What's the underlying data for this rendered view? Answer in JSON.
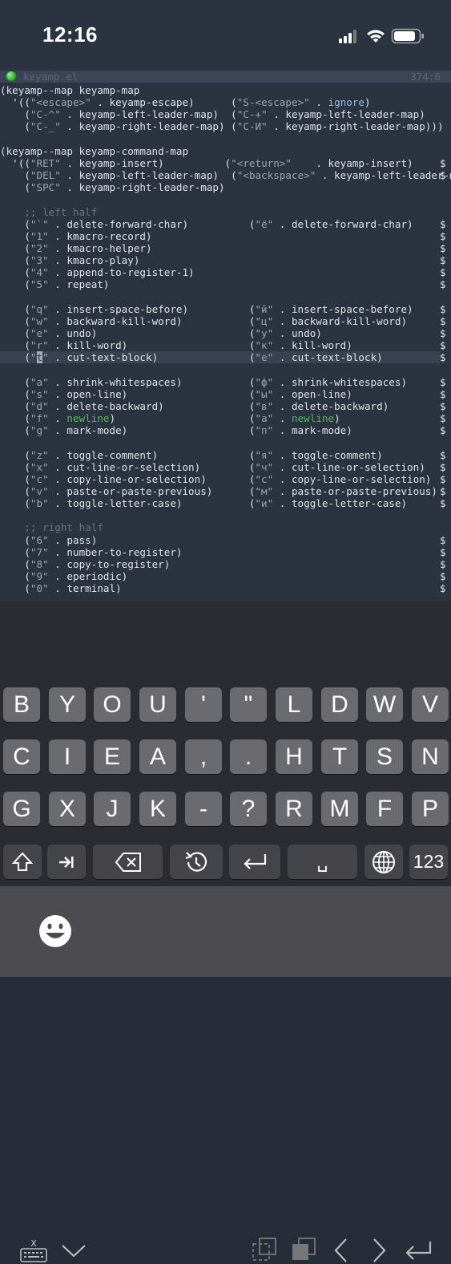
{
  "status_bar": {
    "time": "12:16"
  },
  "editor": {
    "filename": "keyamp.el",
    "position": "374:6",
    "lines": [
      {
        "segs": [
          {
            "t": "(keyamp--map keyamp-map",
            "c": "s"
          }
        ]
      },
      {
        "segs": [
          {
            "t": "  '((",
            "c": "s"
          },
          {
            "t": "\"<escape>\"",
            "c": "q"
          },
          {
            "t": " . keyamp-escape)      (",
            "c": "s"
          },
          {
            "t": "\"S-<escape>\"",
            "c": "q"
          },
          {
            "t": " . ",
            "c": "s"
          },
          {
            "t": "ignore",
            "c": "k"
          },
          {
            "t": ")",
            "c": "s"
          }
        ]
      },
      {
        "segs": [
          {
            "t": "    (",
            "c": "s"
          },
          {
            "t": "\"C-^\"",
            "c": "q"
          },
          {
            "t": " . keyamp-left-leader-map)  (",
            "c": "s"
          },
          {
            "t": "\"C-+\"",
            "c": "q"
          },
          {
            "t": " . keyamp-left-leader-map)",
            "c": "s"
          }
        ]
      },
      {
        "segs": [
          {
            "t": "    (",
            "c": "s"
          },
          {
            "t": "\"C-_\"",
            "c": "q"
          },
          {
            "t": " . keyamp-right-leader-map) (",
            "c": "s"
          },
          {
            "t": "\"C-И\"",
            "c": "q"
          },
          {
            "t": " . keyamp-right-leader-map)))",
            "c": "s"
          }
        ]
      },
      {
        "segs": []
      },
      {
        "segs": [
          {
            "t": "(keyamp--map keyamp-command-map",
            "c": "s"
          }
        ]
      },
      {
        "segs": [
          {
            "t": "  '((",
            "c": "s"
          },
          {
            "t": "\"RET\"",
            "c": "q"
          },
          {
            "t": " . keyamp-insert)          (",
            "c": "s"
          },
          {
            "t": "\"<return>\"",
            "c": "q"
          },
          {
            "t": "    . keyamp-insert)",
            "c": "s"
          }
        ],
        "dollar": true
      },
      {
        "segs": [
          {
            "t": "    (",
            "c": "s"
          },
          {
            "t": "\"DEL\"",
            "c": "q"
          },
          {
            "t": " . keyamp-left-leader-map)  (",
            "c": "s"
          },
          {
            "t": "\"<backspace>\"",
            "c": "q"
          },
          {
            "t": " . keyamp-left-leader-ma",
            "c": "s"
          }
        ],
        "dollar": true
      },
      {
        "segs": [
          {
            "t": "    (",
            "c": "s"
          },
          {
            "t": "\"SPC\"",
            "c": "q"
          },
          {
            "t": " . keyamp-right-leader-map)",
            "c": "s"
          }
        ]
      },
      {
        "segs": []
      },
      {
        "segs": [
          {
            "t": "    ;; left half",
            "c": "c"
          }
        ]
      },
      {
        "segs": [
          {
            "t": "    (",
            "c": "s"
          },
          {
            "t": "\"`\"",
            "c": "q"
          },
          {
            "t": " . delete-forward-char)          (",
            "c": "s"
          },
          {
            "t": "\"ё\"",
            "c": "q"
          },
          {
            "t": " . delete-forward-char)",
            "c": "s"
          }
        ],
        "dollar": true
      },
      {
        "segs": [
          {
            "t": "    (",
            "c": "s"
          },
          {
            "t": "\"1\"",
            "c": "q"
          },
          {
            "t": " . kmacro-record)",
            "c": "s"
          }
        ],
        "dollar": true
      },
      {
        "segs": [
          {
            "t": "    (",
            "c": "s"
          },
          {
            "t": "\"2\"",
            "c": "q"
          },
          {
            "t": " . kmacro-helper)",
            "c": "s"
          }
        ],
        "dollar": true
      },
      {
        "segs": [
          {
            "t": "    (",
            "c": "s"
          },
          {
            "t": "\"3\"",
            "c": "q"
          },
          {
            "t": " . kmacro-play)",
            "c": "s"
          }
        ],
        "dollar": true
      },
      {
        "segs": [
          {
            "t": "    (",
            "c": "s"
          },
          {
            "t": "\"4\"",
            "c": "q"
          },
          {
            "t": " . append-to-register-1)",
            "c": "s"
          }
        ],
        "dollar": true
      },
      {
        "segs": [
          {
            "t": "    (",
            "c": "s"
          },
          {
            "t": "\"5\"",
            "c": "q"
          },
          {
            "t": " . repeat)",
            "c": "s"
          }
        ],
        "dollar": true
      },
      {
        "segs": []
      },
      {
        "segs": [
          {
            "t": "    (",
            "c": "s"
          },
          {
            "t": "\"q\"",
            "c": "q"
          },
          {
            "t": " . insert-space-before)          (",
            "c": "s"
          },
          {
            "t": "\"й\"",
            "c": "q"
          },
          {
            "t": " . insert-space-before)",
            "c": "s"
          }
        ],
        "dollar": true
      },
      {
        "segs": [
          {
            "t": "    (",
            "c": "s"
          },
          {
            "t": "\"w\"",
            "c": "q"
          },
          {
            "t": " . backward-kill-word)           (",
            "c": "s"
          },
          {
            "t": "\"ц\"",
            "c": "q"
          },
          {
            "t": " . backward-kill-word)",
            "c": "s"
          }
        ],
        "dollar": true
      },
      {
        "segs": [
          {
            "t": "    (",
            "c": "s"
          },
          {
            "t": "\"e\"",
            "c": "q"
          },
          {
            "t": " . undo)                         (",
            "c": "s"
          },
          {
            "t": "\"у\"",
            "c": "q"
          },
          {
            "t": " . undo)",
            "c": "s"
          }
        ],
        "dollar": true
      },
      {
        "segs": [
          {
            "t": "    (",
            "c": "s"
          },
          {
            "t": "\"r\"",
            "c": "q"
          },
          {
            "t": " . kill-word)                    (",
            "c": "s"
          },
          {
            "t": "\"к\"",
            "c": "q"
          },
          {
            "t": " . kill-word)",
            "c": "s"
          }
        ],
        "dollar": true
      },
      {
        "segs": [
          {
            "t": "    (",
            "c": "s"
          },
          {
            "t": "\"",
            "c": "q"
          },
          {
            "t": "t",
            "c": "cursor"
          },
          {
            "t": "\"",
            "c": "q"
          },
          {
            "t": " . cut-text-block)               (",
            "c": "s"
          },
          {
            "t": "\"е\"",
            "c": "q"
          },
          {
            "t": " . cut-text-block)",
            "c": "s"
          }
        ],
        "dollar": true,
        "hl": true
      },
      {
        "segs": []
      },
      {
        "segs": [
          {
            "t": "    (",
            "c": "s"
          },
          {
            "t": "\"a\"",
            "c": "q"
          },
          {
            "t": " . shrink-whitespaces)           (",
            "c": "s"
          },
          {
            "t": "\"ф\"",
            "c": "q"
          },
          {
            "t": " . shrink-whitespaces)",
            "c": "s"
          }
        ],
        "dollar": true
      },
      {
        "segs": [
          {
            "t": "    (",
            "c": "s"
          },
          {
            "t": "\"s\"",
            "c": "q"
          },
          {
            "t": " . open-line)                    (",
            "c": "s"
          },
          {
            "t": "\"ы\"",
            "c": "q"
          },
          {
            "t": " . open-line)",
            "c": "s"
          }
        ],
        "dollar": true
      },
      {
        "segs": [
          {
            "t": "    (",
            "c": "s"
          },
          {
            "t": "\"d\"",
            "c": "q"
          },
          {
            "t": " . delete-backward)              (",
            "c": "s"
          },
          {
            "t": "\"в\"",
            "c": "q"
          },
          {
            "t": " . delete-backward)",
            "c": "s"
          }
        ],
        "dollar": true
      },
      {
        "segs": [
          {
            "t": "    (",
            "c": "s"
          },
          {
            "t": "\"f\"",
            "c": "q"
          },
          {
            "t": " . ",
            "c": "s"
          },
          {
            "t": "newline",
            "c": "g"
          },
          {
            "t": ")                      (",
            "c": "s"
          },
          {
            "t": "\"а\"",
            "c": "q"
          },
          {
            "t": " . ",
            "c": "s"
          },
          {
            "t": "newline",
            "c": "g"
          },
          {
            "t": ")",
            "c": "s"
          }
        ],
        "dollar": true
      },
      {
        "segs": [
          {
            "t": "    (",
            "c": "s"
          },
          {
            "t": "\"g\"",
            "c": "q"
          },
          {
            "t": " . mark-mode)                    (",
            "c": "s"
          },
          {
            "t": "\"п\"",
            "c": "q"
          },
          {
            "t": " . mark-mode)",
            "c": "s"
          }
        ],
        "dollar": true
      },
      {
        "segs": []
      },
      {
        "segs": [
          {
            "t": "    (",
            "c": "s"
          },
          {
            "t": "\"z\"",
            "c": "q"
          },
          {
            "t": " . toggle-comment)               (",
            "c": "s"
          },
          {
            "t": "\"я\"",
            "c": "q"
          },
          {
            "t": " . toggle-comment)",
            "c": "s"
          }
        ],
        "dollar": true
      },
      {
        "segs": [
          {
            "t": "    (",
            "c": "s"
          },
          {
            "t": "\"x\"",
            "c": "q"
          },
          {
            "t": " . cut-line-or-selection)        (",
            "c": "s"
          },
          {
            "t": "\"ч\"",
            "c": "q"
          },
          {
            "t": " . cut-line-or-selection)",
            "c": "s"
          }
        ],
        "dollar": true
      },
      {
        "segs": [
          {
            "t": "    (",
            "c": "s"
          },
          {
            "t": "\"c\"",
            "c": "q"
          },
          {
            "t": " . copy-line-or-selection)       (",
            "c": "s"
          },
          {
            "t": "\"с\"",
            "c": "q"
          },
          {
            "t": " . copy-line-or-selection)",
            "c": "s"
          }
        ],
        "dollar": true
      },
      {
        "segs": [
          {
            "t": "    (",
            "c": "s"
          },
          {
            "t": "\"v\"",
            "c": "q"
          },
          {
            "t": " . paste-or-paste-previous)      (",
            "c": "s"
          },
          {
            "t": "\"м\"",
            "c": "q"
          },
          {
            "t": " . paste-or-paste-previous)",
            "c": "s"
          }
        ],
        "dollar": true
      },
      {
        "segs": [
          {
            "t": "    (",
            "c": "s"
          },
          {
            "t": "\"b\"",
            "c": "q"
          },
          {
            "t": " . toggle-letter-case)           (",
            "c": "s"
          },
          {
            "t": "\"и\"",
            "c": "q"
          },
          {
            "t": " . toggle-letter-case)",
            "c": "s"
          }
        ],
        "dollar": true
      },
      {
        "segs": []
      },
      {
        "segs": [
          {
            "t": "    ;; right half",
            "c": "c"
          }
        ]
      },
      {
        "segs": [
          {
            "t": "    (",
            "c": "s"
          },
          {
            "t": "\"6\"",
            "c": "q"
          },
          {
            "t": " . pass)",
            "c": "s"
          }
        ],
        "dollar": true
      },
      {
        "segs": [
          {
            "t": "    (",
            "c": "s"
          },
          {
            "t": "\"7\"",
            "c": "q"
          },
          {
            "t": " . number-to-register)",
            "c": "s"
          }
        ],
        "dollar": true
      },
      {
        "segs": [
          {
            "t": "    (",
            "c": "s"
          },
          {
            "t": "\"8\"",
            "c": "q"
          },
          {
            "t": " . copy-to-register)",
            "c": "s"
          }
        ],
        "dollar": true
      },
      {
        "segs": [
          {
            "t": "    (",
            "c": "s"
          },
          {
            "t": "\"9\"",
            "c": "q"
          },
          {
            "t": " . eperiodic)",
            "c": "s"
          }
        ],
        "dollar": true
      },
      {
        "segs": [
          {
            "t": "    (",
            "c": "s"
          },
          {
            "t": "\"0\"",
            "c": "q"
          },
          {
            "t": " . terminal)",
            "c": "s"
          }
        ],
        "dollar": true
      }
    ]
  },
  "keyboard": {
    "rows": [
      [
        "B",
        "Y",
        "O",
        "U",
        "'",
        "\"",
        "L",
        "D",
        "W",
        "V"
      ],
      [
        "C",
        "I",
        "E",
        "A",
        ",",
        ".",
        "H",
        "T",
        "S",
        "N"
      ],
      [
        "G",
        "X",
        "J",
        "K",
        "-",
        "?",
        "R",
        "M",
        "F",
        "P"
      ]
    ],
    "numbers_label": "123",
    "space_label": "␣"
  },
  "toolbar": {
    "icons": [
      "hide-keyboard-icon",
      "chevron-down-icon",
      "select-icon",
      "copy-icon",
      "left-arrow-icon",
      "right-arrow-icon",
      "return-icon"
    ]
  }
}
